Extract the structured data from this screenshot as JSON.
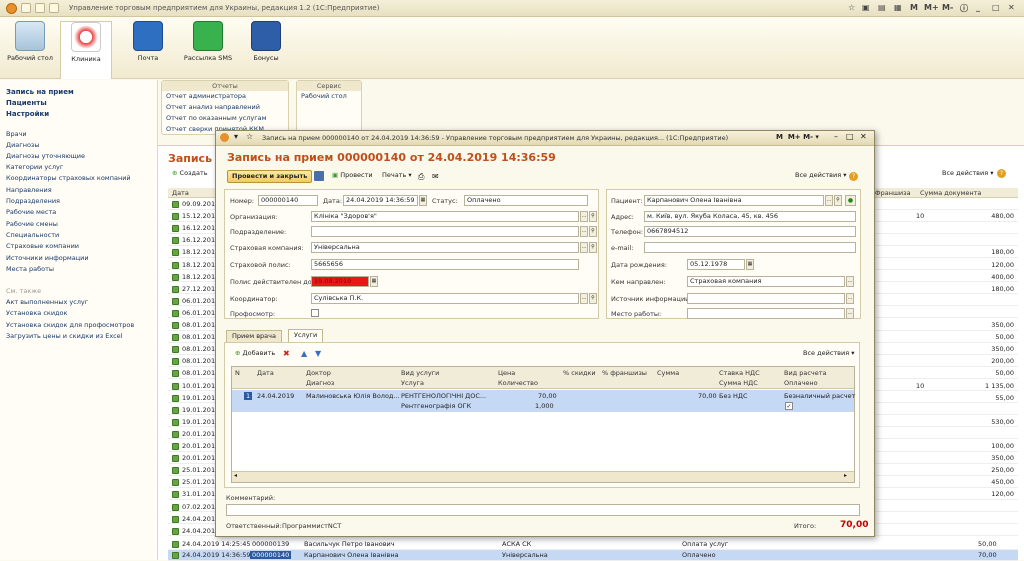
{
  "app_title": "Управление торговым предприятием для Украины, редакция 1.2  (1С:Предприятие)",
  "toolbar": {
    "items": [
      {
        "label": "Рабочий стол"
      },
      {
        "label": "Клиника"
      },
      {
        "label": "Почта"
      },
      {
        "label": "Рассылка SMS"
      },
      {
        "label": "Бонусы"
      }
    ],
    "right_m": "M",
    "right_mplus": "M+",
    "right_mminus": "M-"
  },
  "left_panel": {
    "top_links": [
      "Запись на прием",
      "Пациенты",
      "Настройки"
    ],
    "links": [
      "Врачи",
      "Диагнозы",
      "Диагнозы уточняющие",
      "Категории услуг",
      "Координаторы страховых компаний",
      "Направления",
      "Подразделения",
      "Рабочие места",
      "Рабочие смены",
      "Специальности",
      "Страховые компании",
      "Источники информации",
      "Места работы"
    ],
    "see_also_title": "См. также",
    "see_also": [
      "Акт выполненных услуг",
      "Установка скидок",
      "Установка скидок для профосмотров",
      "Загрузить цены и скидки из Excel"
    ]
  },
  "reports": {
    "title": "Отчеты",
    "items": [
      "Отчет администратора",
      "Отчет анализ направлений",
      "Отчет по оказанным услугам",
      "Отчет сверки принятой ККМ"
    ]
  },
  "service": {
    "title": "Сервис",
    "items": [
      "Рабочий стол"
    ]
  },
  "background_list": {
    "title": "Запись на",
    "create_label": "Создать",
    "all_actions": "Все действия ▾",
    "col_date": "Дата",
    "col_franchise": "Франшиза",
    "col_sum": "Сумма документа",
    "rows": [
      {
        "date": "09.09.201",
        "fr": "",
        "sum": ""
      },
      {
        "date": "15.12.201",
        "fr": "10",
        "sum": "480,00"
      },
      {
        "date": "16.12.201",
        "fr": "",
        "sum": ""
      },
      {
        "date": "16.12.201",
        "fr": "",
        "sum": ""
      },
      {
        "date": "18.12.201",
        "fr": "",
        "sum": "180,00"
      },
      {
        "date": "18.12.201",
        "fr": "",
        "sum": "120,00"
      },
      {
        "date": "18.12.201",
        "fr": "",
        "sum": "400,00"
      },
      {
        "date": "27.12.201",
        "fr": "",
        "sum": "180,00"
      },
      {
        "date": "06.01.201",
        "fr": "",
        "sum": ""
      },
      {
        "date": "06.01.201",
        "fr": "",
        "sum": ""
      },
      {
        "date": "08.01.201",
        "fr": "",
        "sum": "350,00"
      },
      {
        "date": "08.01.201",
        "fr": "",
        "sum": "50,00"
      },
      {
        "date": "08.01.201",
        "fr": "",
        "sum": "350,00"
      },
      {
        "date": "08.01.201",
        "fr": "",
        "sum": "200,00"
      },
      {
        "date": "08.01.201",
        "fr": "",
        "sum": "50,00"
      },
      {
        "date": "10.01.201",
        "fr": "10",
        "sum": "1 135,00"
      },
      {
        "date": "19.01.201",
        "fr": "",
        "sum": "55,00"
      },
      {
        "date": "19.01.201",
        "fr": "",
        "sum": ""
      },
      {
        "date": "19.01.201",
        "fr": "",
        "sum": "530,00"
      },
      {
        "date": "20.01.201",
        "fr": "",
        "sum": ""
      },
      {
        "date": "20.01.201",
        "fr": "",
        "sum": "100,00"
      },
      {
        "date": "20.01.201",
        "fr": "",
        "sum": "350,00"
      },
      {
        "date": "25.01.201",
        "fr": "",
        "sum": "250,00"
      },
      {
        "date": "25.01.201",
        "fr": "",
        "sum": "450,00"
      },
      {
        "date": "31.01.201",
        "fr": "",
        "sum": "120,00"
      },
      {
        "date": "07.02.201",
        "fr": "",
        "sum": ""
      },
      {
        "date": "24.04.201",
        "fr": "",
        "sum": ""
      },
      {
        "date": "24.04.201",
        "fr": "",
        "sum": ""
      }
    ],
    "tail_rows": [
      {
        "date": "24.04.2019 14:25:45",
        "num": "000000139",
        "patient": "Васильчук Петро Іванович",
        "ins": "АСКА СК",
        "status": "Оплата услуг",
        "sum": "50,00"
      },
      {
        "date": "24.04.2019 14:36:59",
        "num": "000000140",
        "patient": "Карпанович Олена Іванівна",
        "ins": "Універсальна",
        "status": "Оплачено",
        "sum": "70,00"
      }
    ]
  },
  "dialog": {
    "window_title": "Запись на прием 000000140 от 24.04.2019 14:36:59 - Управление торговым предприятием для Украины, редакция...  (1С:Предприятие)",
    "heading": "Запись на прием 000000140 от 24.04.2019 14:36:59",
    "btn_post_close": "Провести и закрыть",
    "btn_post": "Провести",
    "btn_print": "Печать ▾",
    "all_actions": "Все действия ▾",
    "fields": {
      "number_label": "Номер:",
      "number": "000000140",
      "date_label": "Дата:",
      "date": "24.04.2019 14:36:59",
      "status_label": "Статус:",
      "status": "Оплачено",
      "org_label": "Организация:",
      "org": "Клініка \"Здоров'я\"",
      "dept_label": "Подразделение:",
      "dept": "",
      "ins_label": "Страховая компания:",
      "ins": "Універсальна",
      "policy_label": "Страховой полис:",
      "policy": "5665656",
      "policy_valid_label": "Полис действителен до:",
      "policy_valid": "19.08.2019",
      "coord_label": "Координатор:",
      "coord": "Сулівська П.К.",
      "prof_label": "Профосмотр:",
      "patient_label": "Пациент:",
      "patient": "Карпанович Олена Іванівна",
      "address_label": "Адрес:",
      "address": "м. Київ, вул. Якуба Коласа, 45, кв. 456",
      "phone_label": "Телефон:",
      "phone": "0667894512",
      "email_label": "e-mail:",
      "email": "",
      "birth_label": "Дата рождения:",
      "birth": "05.12.1978",
      "sent_by_label": "Кем направлен:",
      "sent_by": "Страховая компания",
      "source_label": "Источник информации:",
      "source": "",
      "workplace_label": "Место работы:",
      "workplace": ""
    },
    "tabs": [
      "Прием врача",
      "Услуги"
    ],
    "add_label": "Добавить",
    "table_header1": [
      "N",
      "Дата",
      "Доктор",
      "Вид услуги",
      "Цена",
      "% скидки",
      "% франшизы",
      "Сумма",
      "Ставка НДС",
      "Вид расчета"
    ],
    "table_header2": [
      "Диагноз",
      "Услуга",
      "Количество",
      "Сумма НДС",
      "Оплачено"
    ],
    "row": {
      "n": "1",
      "date": "24.04.2019",
      "doctor": "Малиновська Юлія Волод...",
      "service_kind": "РЕНТГЕНОЛОГІЧНІ ДОС...",
      "service": "Рентгенографія ОГК",
      "price": "70,00",
      "qty": "1,000",
      "sum": "70,00",
      "vat": "Без НДС",
      "calc": "Безналичный расчет",
      "paid": "✓"
    },
    "comment_label": "Комментарий:",
    "resp_label": "Ответственный:",
    "resp": "ПрограммистNCT",
    "total_label": "Итого:",
    "total": "70,00"
  },
  "colors": {
    "accent": "#c0501a",
    "total": "#c00000",
    "selection": "#c5d9f5",
    "selected_row_bg": "#c5d9f5"
  }
}
